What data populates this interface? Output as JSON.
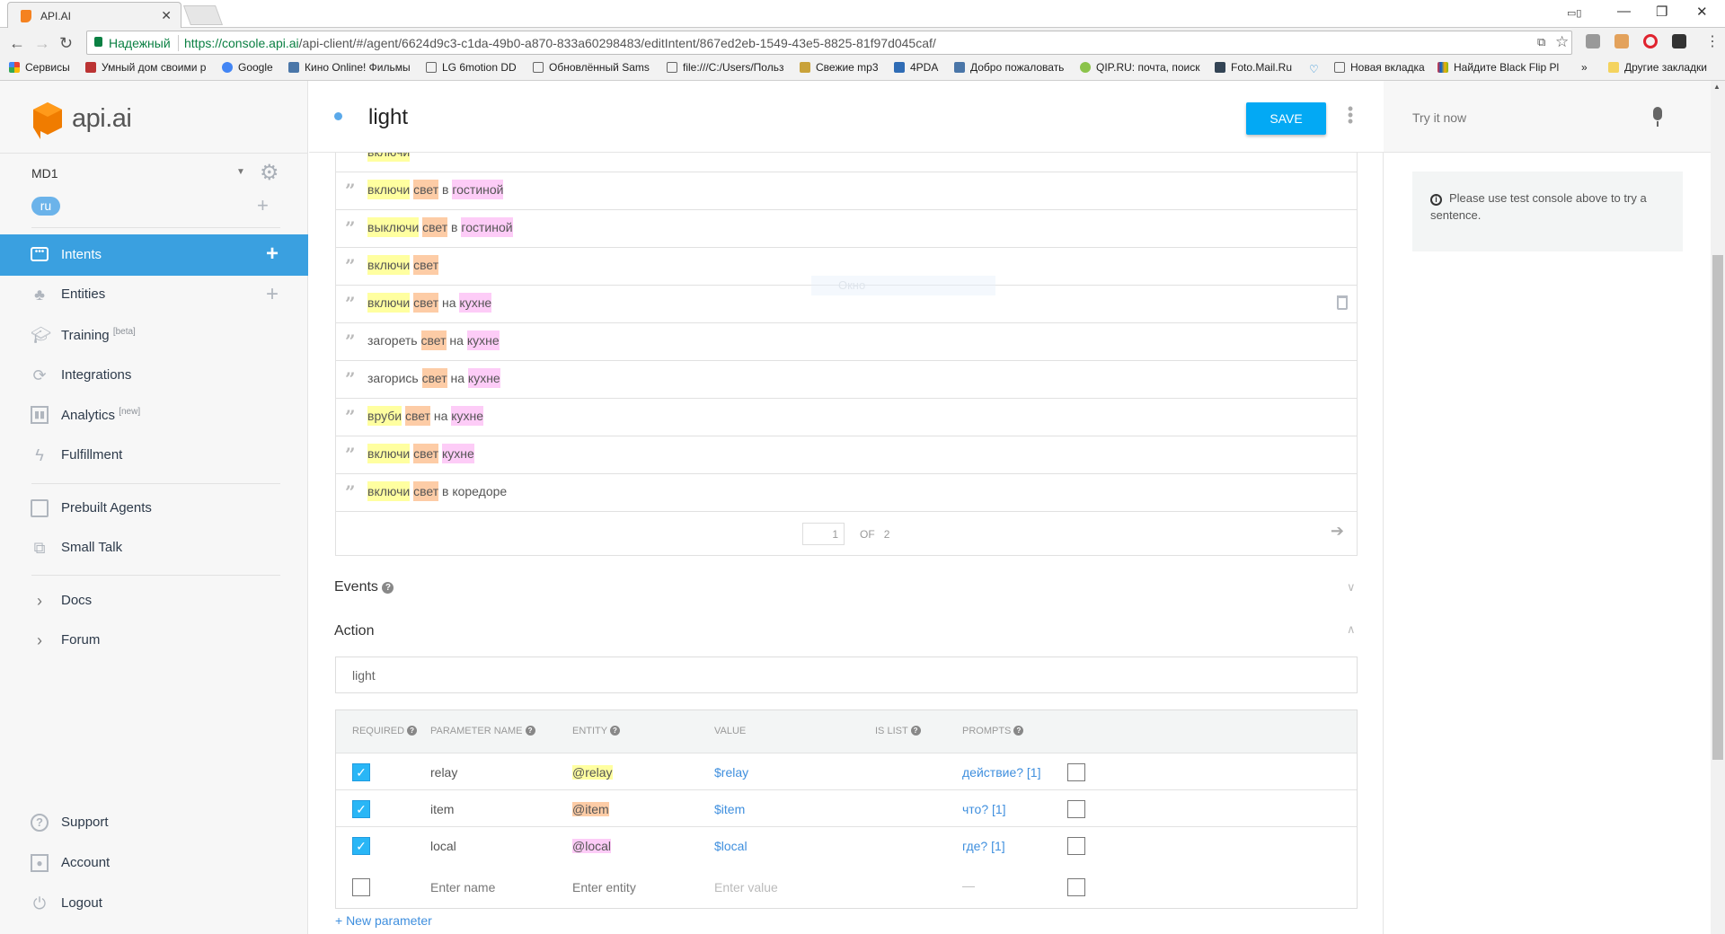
{
  "browser": {
    "tab_title": "API.AI",
    "secure_label": "Надежный",
    "url_host": "https://console.api.ai",
    "url_path": "/api-client/#/agent/6624d9c3-c1da-49b0-a870-833a60298483/editIntent/867ed2eb-1549-43e5-8825-81f97d045caf/",
    "bookmarks": [
      "Сервисы",
      "Умный дом своими р",
      "Google",
      "Кино Online! Фильмы",
      "LG 6motion DD",
      "Обновлённый Sams",
      "file:///C:/Users/Польз",
      "Свежие mp3",
      "4PDA",
      "Добро пожаловать",
      "QIP.RU: почта, поиск",
      "Foto.Mail.Ru",
      "",
      "Новая вкладка",
      "Найдите Black Flip Pl",
      "»",
      "Другие закладки"
    ]
  },
  "sidebar": {
    "logo_text": "api.ai",
    "agent_name": "MD1",
    "language": "ru",
    "items": [
      {
        "label": "Intents",
        "icon": "chat-bubble-icon",
        "active": true
      },
      {
        "label": "Entities",
        "icon": "hierarchy-icon"
      },
      {
        "label": "Training",
        "badge": "[beta]",
        "icon": "graduation-cap-icon"
      },
      {
        "label": "Integrations",
        "icon": "sync-icon"
      },
      {
        "label": "Analytics",
        "badge": "[new]",
        "icon": "bar-chart-icon"
      },
      {
        "label": "Fulfillment",
        "icon": "lightning-icon"
      },
      {
        "label": "Prebuilt Agents",
        "icon": "book-icon"
      },
      {
        "label": "Small Talk",
        "icon": "chat-windows-icon"
      },
      {
        "label": "Docs",
        "icon": "chevron-right-icon"
      },
      {
        "label": "Forum",
        "icon": "chevron-right-icon"
      },
      {
        "label": "Support",
        "icon": "help-circle-icon"
      },
      {
        "label": "Account",
        "icon": "account-icon"
      },
      {
        "label": "Logout",
        "icon": "power-icon"
      }
    ]
  },
  "header": {
    "intent_name": "light",
    "save_label": "SAVE"
  },
  "colors": {
    "accent": "#3aa0e0",
    "save": "#03a9f4",
    "relay": "#ffffa0",
    "item": "#fdcca6",
    "local": "#fdccf7"
  },
  "utterances": [
    [
      {
        "t": "включи",
        "c": "y"
      }
    ],
    [
      {
        "t": "включи",
        "c": "y"
      },
      {
        "t": " "
      },
      {
        "t": "свет",
        "c": "o"
      },
      {
        "t": " в "
      },
      {
        "t": "гостиной",
        "c": "p"
      }
    ],
    [
      {
        "t": "выключи",
        "c": "y"
      },
      {
        "t": " "
      },
      {
        "t": "свет",
        "c": "o"
      },
      {
        "t": " в "
      },
      {
        "t": "гостиной",
        "c": "p"
      }
    ],
    [
      {
        "t": "включи",
        "c": "y"
      },
      {
        "t": " "
      },
      {
        "t": "свет",
        "c": "o"
      }
    ],
    [
      {
        "t": "включи",
        "c": "y"
      },
      {
        "t": " "
      },
      {
        "t": "свет",
        "c": "o"
      },
      {
        "t": " на "
      },
      {
        "t": "кухне",
        "c": "p"
      }
    ],
    [
      {
        "t": "загореть "
      },
      {
        "t": "свет",
        "c": "o"
      },
      {
        "t": " на "
      },
      {
        "t": "кухне",
        "c": "p"
      }
    ],
    [
      {
        "t": "загорись "
      },
      {
        "t": "свет",
        "c": "o"
      },
      {
        "t": " на "
      },
      {
        "t": "кухне",
        "c": "p"
      }
    ],
    [
      {
        "t": "вруби",
        "c": "y"
      },
      {
        "t": " "
      },
      {
        "t": "свет",
        "c": "o"
      },
      {
        "t": " на "
      },
      {
        "t": "кухне",
        "c": "p"
      }
    ],
    [
      {
        "t": "включи",
        "c": "y"
      },
      {
        "t": " "
      },
      {
        "t": "свет",
        "c": "o"
      },
      {
        "t": " "
      },
      {
        "t": "кухне",
        "c": "p"
      }
    ],
    [
      {
        "t": "включи",
        "c": "y"
      },
      {
        "t": " "
      },
      {
        "t": "свет",
        "c": "o"
      },
      {
        "t": " в коредоре"
      }
    ]
  ],
  "tooltip_ghost": "Окно",
  "pagination": {
    "page": "1",
    "of_label": "OF",
    "total": "2"
  },
  "events": {
    "title": "Events"
  },
  "action": {
    "title": "Action",
    "value": "light"
  },
  "parameters": {
    "headers": [
      "REQUIRED",
      "PARAMETER NAME",
      "ENTITY",
      "VALUE",
      "IS LIST",
      "PROMPTS"
    ],
    "rows": [
      {
        "required": true,
        "name": "relay",
        "entity": "@relay",
        "entity_color": "y",
        "value": "$relay",
        "is_list": false,
        "prompts": "действие? [1]"
      },
      {
        "required": true,
        "name": "item",
        "entity": "@item",
        "entity_color": "o",
        "value": "$item",
        "is_list": false,
        "prompts": "что? [1]"
      },
      {
        "required": true,
        "name": "local",
        "entity": "@local",
        "entity_color": "p",
        "value": "$local",
        "is_list": false,
        "prompts": "где? [1]"
      }
    ],
    "new_row": {
      "name_placeholder": "Enter name",
      "entity_placeholder": "Enter entity",
      "value_placeholder": "Enter value",
      "prompts": "—"
    },
    "add_label": "+ New parameter"
  },
  "test_console": {
    "placeholder": "Try it now",
    "info": "Please use test console above to try a sentence."
  }
}
